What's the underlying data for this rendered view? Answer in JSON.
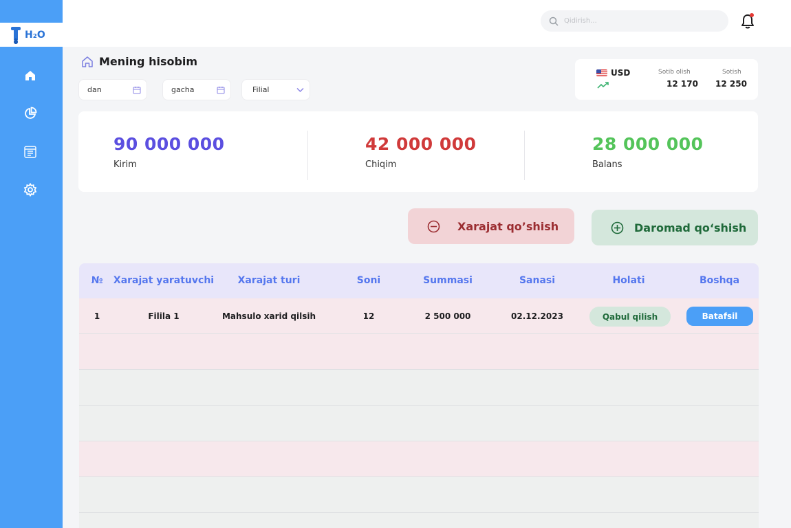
{
  "brand": {
    "logo_text": "H₂O",
    "tagline": ""
  },
  "colors": {
    "sidebar": "#4b9ff7",
    "income": "#5b4fe0",
    "expense": "#d03a3a",
    "balance": "#54c45a",
    "table_header_text": "#5577ee"
  },
  "sidebar": {
    "items": [
      {
        "icon": "home-icon"
      },
      {
        "icon": "pie-chart-icon"
      },
      {
        "icon": "report-icon"
      },
      {
        "icon": "settings-icon"
      }
    ]
  },
  "topbar": {
    "search_placeholder": "Qidirish...",
    "notification_icon": "bell-icon"
  },
  "page": {
    "title": "Mening hisobim"
  },
  "filters": {
    "from": "dan",
    "to": "gacha",
    "branch": "Filial"
  },
  "currency": {
    "code": "USD",
    "buy_label": "Sotib olish",
    "buy_value": "12 170",
    "sell_label": "Sotish",
    "sell_value": "12 250"
  },
  "stats": [
    {
      "value": "90 000 000",
      "label": "Kirim"
    },
    {
      "value": "42 000 000",
      "label": "Chiqim"
    },
    {
      "value": "28 000 000",
      "label": "Balans"
    }
  ],
  "actions": {
    "add_expense": "Xarajat qo’shish",
    "add_income": "Daromad qo‘shish"
  },
  "table": {
    "headers": [
      "№",
      "Xarajat yaratuvchi",
      "Xarajat turi",
      "Soni",
      "Summasi",
      "Sanasi",
      "Holati",
      "Boshqa"
    ],
    "rows": [
      {
        "no": "1",
        "creator": "Filila 1",
        "type": "Mahsulo xarid qilsih",
        "count": "12",
        "amount": "2 500 000",
        "date": "02.12.2023",
        "status": "Qabul qilish",
        "action": "Batafsil"
      }
    ]
  }
}
